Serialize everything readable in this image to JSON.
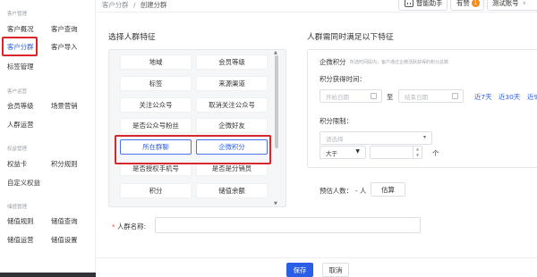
{
  "sidebar": {
    "sections": [
      {
        "title": "客户管理"
      },
      {
        "title": "客户运营"
      },
      {
        "title": "权益管理"
      },
      {
        "title": "储值管理"
      }
    ],
    "items": [
      {
        "label": "客户概况"
      },
      {
        "label": "客户查询"
      },
      {
        "label": "客户分群"
      },
      {
        "label": "客户导入"
      },
      {
        "label": "标签管理"
      },
      {
        "label": "会员等级"
      },
      {
        "label": "场景营销"
      },
      {
        "label": "人群运营"
      },
      {
        "label": "权益卡"
      },
      {
        "label": "积分规则"
      },
      {
        "label": "自定义权益"
      },
      {
        "label": "储值规则"
      },
      {
        "label": "储值查询"
      },
      {
        "label": "储值运营"
      },
      {
        "label": "储值设置"
      }
    ]
  },
  "header": {
    "breadcrumb_parent": "客户分群",
    "breadcrumb_sep": "/",
    "breadcrumb_current": "创建分群",
    "assistant_label": "智能助手",
    "praise_label": "有赞",
    "praise_badge": "1",
    "account_label": "测试账号",
    "account_caret": "∨"
  },
  "features": {
    "title": "选择人群特征",
    "buttons": [
      {
        "label": "地域"
      },
      {
        "label": "会员等级"
      },
      {
        "label": "标签"
      },
      {
        "label": "来源渠道"
      },
      {
        "label": "关注公众号"
      },
      {
        "label": "取消关注公众号"
      },
      {
        "label": "是否公众号粉丝"
      },
      {
        "label": "企微好友"
      },
      {
        "label": "所在群聊"
      },
      {
        "label": "企微积分"
      },
      {
        "label": "是否授权手机号"
      },
      {
        "label": "是否是分销员"
      },
      {
        "label": "积分"
      },
      {
        "label": "储值余额"
      }
    ]
  },
  "conditions": {
    "title": "人群需同时满足以下特征",
    "points_label": "企微积分",
    "points_hint": "所选时间段内，客户通过企微活跃获得的积分总数",
    "time_label": "积分获得时间：",
    "start_placeholder": "开始日期",
    "to_label": "至",
    "end_placeholder": "结束日期",
    "quick_ranges": [
      "近7天",
      "近30天",
      "近9"
    ],
    "limit_label": "积分限制：",
    "select_placeholder": "请选择",
    "operator_value": "大于",
    "unit_label": "个"
  },
  "estimate": {
    "label": "预估人数：",
    "value": "- 人",
    "button": "估算"
  },
  "name_field": {
    "required_mark": "*",
    "label": "人群名称:"
  },
  "footer": {
    "save": "保存",
    "cancel": "取消"
  },
  "colors": {
    "accent": "#2a5ee6",
    "highlight_box": "#d9262c",
    "badge": "#f28b1c"
  }
}
